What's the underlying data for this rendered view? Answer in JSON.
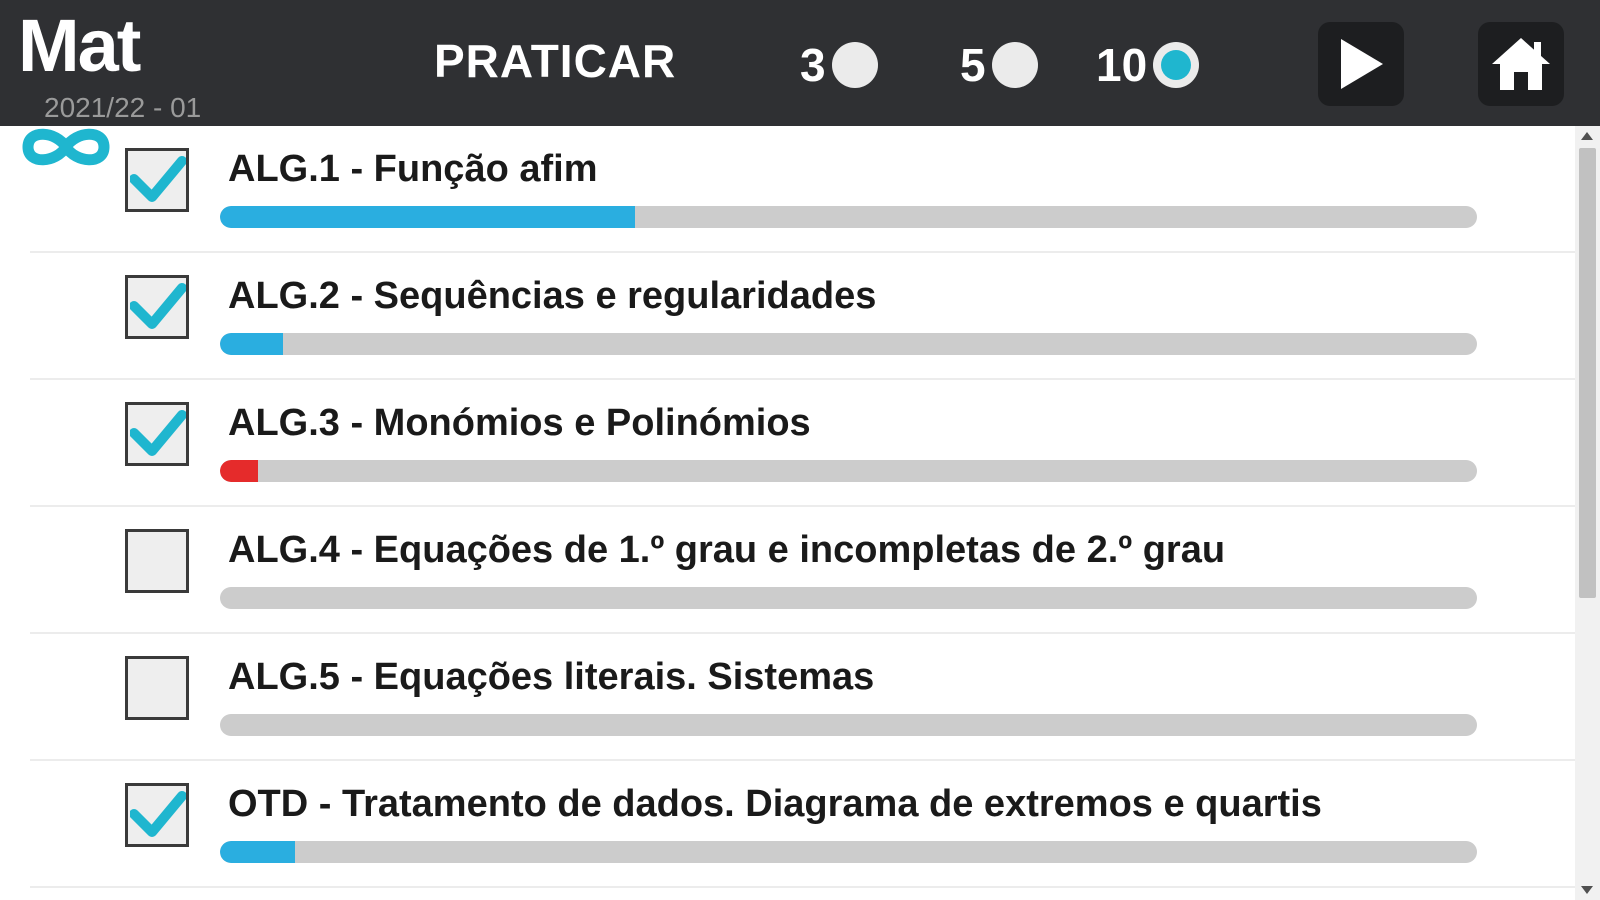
{
  "header": {
    "logo_left": "Mat",
    "logo_right": "8",
    "year": "2021/22 - 01",
    "mode_title": "PRATICAR",
    "counts": [
      {
        "label": "3",
        "selected": false
      },
      {
        "label": "5",
        "selected": false
      },
      {
        "label": "10",
        "selected": true
      }
    ],
    "play_icon": "play-icon",
    "home_icon": "home-icon"
  },
  "colors": {
    "header_bg": "#2f3033",
    "accent": "#1fb6cf",
    "progress_blue": "#2aaee0",
    "progress_red": "#e52b2b",
    "progress_track": "#cccccc"
  },
  "topics": [
    {
      "label": "ALG.1 - Função afim",
      "checked": true,
      "progress": 0.33,
      "color": "#2aaee0"
    },
    {
      "label": "ALG.2 - Sequências e regularidades",
      "checked": true,
      "progress": 0.05,
      "color": "#2aaee0"
    },
    {
      "label": "ALG.3 - Monómios e Polinómios",
      "checked": true,
      "progress": 0.03,
      "color": "#e52b2b"
    },
    {
      "label": "ALG.4 - Equações de 1.º grau e incompletas de 2.º grau",
      "checked": false,
      "progress": 0,
      "color": "#2aaee0"
    },
    {
      "label": "ALG.5 - Equações literais. Sistemas",
      "checked": false,
      "progress": 0,
      "color": "#2aaee0"
    },
    {
      "label": "OTD - Tratamento de dados. Diagrama de extremos e quartis",
      "checked": true,
      "progress": 0.06,
      "color": "#2aaee0"
    }
  ]
}
